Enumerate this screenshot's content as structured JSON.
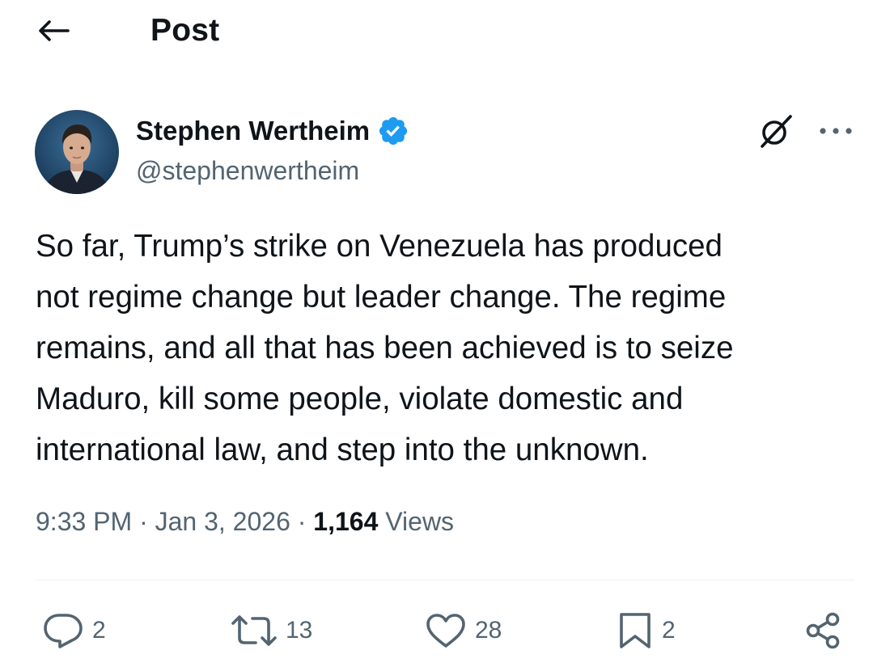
{
  "header": {
    "title": "Post",
    "back_icon": "arrow-left-icon"
  },
  "author": {
    "display_name": "Stephen Wertheim",
    "handle": "@stephenwertheim",
    "verified": true,
    "verified_color": "#1d9bf0"
  },
  "post": {
    "text": "So far, Trump’s strike on Venezuela has produced\nnot regime change but leader change. The regime\nremains, and all that has been achieved is to seize\nMaduro, kill some people, violate domestic and\ninternational law, and step into the unknown.",
    "time": "9:33 PM",
    "separator": "·",
    "date": "Jan 3, 2026",
    "views_count": "1,164",
    "views_label": "Views"
  },
  "actions": {
    "reply_count": "2",
    "repost_count": "13",
    "like_count": "28",
    "bookmark_count": "2"
  },
  "colors": {
    "text_primary": "#0f1419",
    "text_secondary": "#536471",
    "divider": "#eff3f4",
    "accent": "#1d9bf0"
  }
}
